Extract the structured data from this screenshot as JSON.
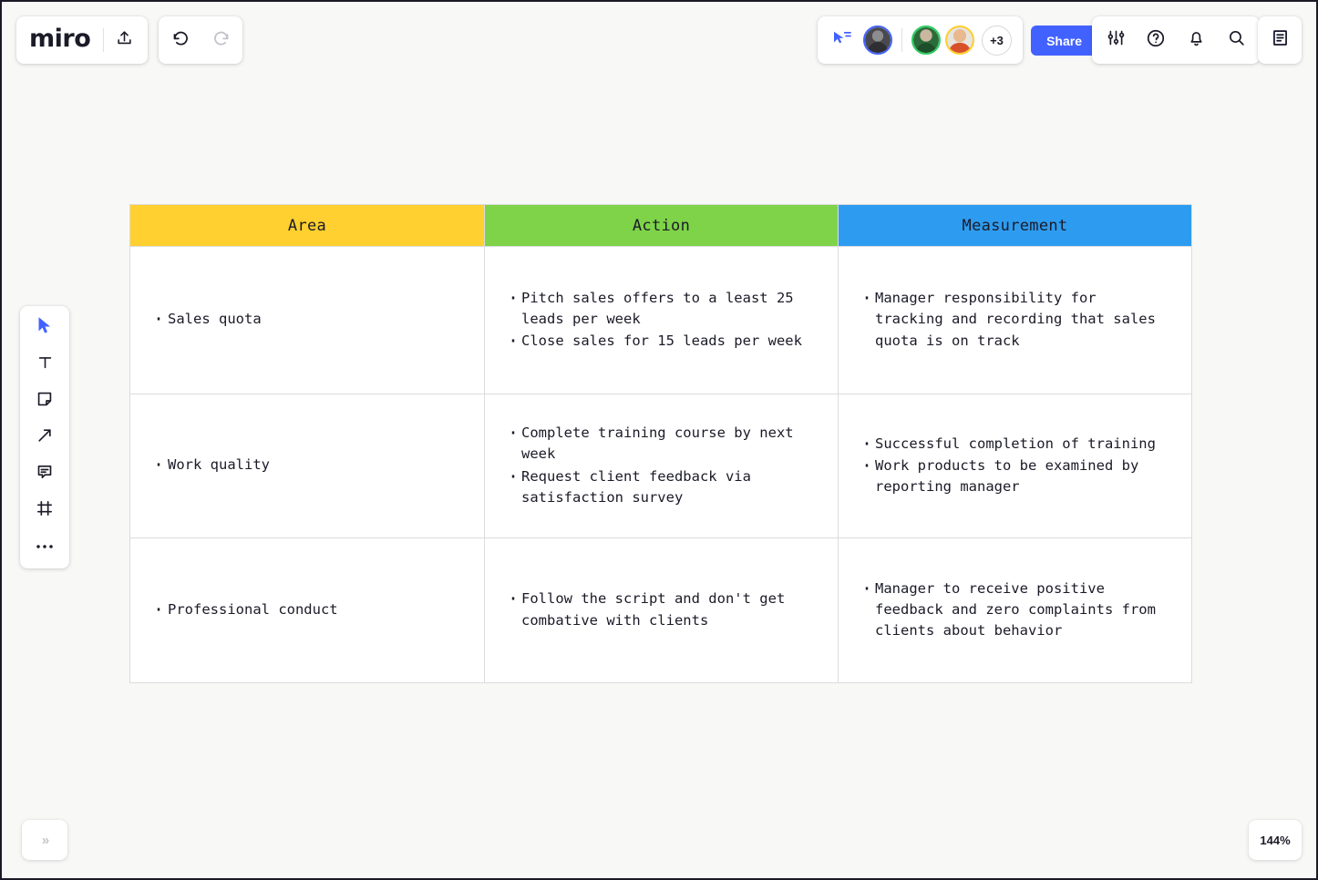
{
  "app": {
    "name": "miro",
    "zoom_level": "144%",
    "collapse_label": "»"
  },
  "toolbar_top": {
    "upload_icon": "upload-icon",
    "undo_icon": "undo-icon",
    "redo_icon": "redo-icon",
    "cursor_share_icon": "cursor-share-icon",
    "avatars": [
      {
        "name": "collaborator-1",
        "ring_color": "#4262ff"
      },
      {
        "name": "collaborator-2",
        "ring_color": "#2ecc5f"
      },
      {
        "name": "collaborator-3",
        "ring_color": "#ffd02f"
      }
    ],
    "avatar_overflow_label": "+3",
    "share_label": "Share",
    "actions": [
      {
        "name": "settings-sliders-icon"
      },
      {
        "name": "help-circle-icon"
      },
      {
        "name": "notification-bell-icon"
      },
      {
        "name": "search-icon"
      }
    ],
    "notes_icon": "notes-panel-icon"
  },
  "toolbar_left": {
    "tools": [
      {
        "name": "cursor-select-tool",
        "selected": true
      },
      {
        "name": "text-tool",
        "selected": false
      },
      {
        "name": "sticky-note-tool",
        "selected": false
      },
      {
        "name": "connector-arrow-tool",
        "selected": false
      },
      {
        "name": "comment-tool",
        "selected": false
      },
      {
        "name": "frame-tool",
        "selected": false
      },
      {
        "name": "more-tools",
        "selected": false
      }
    ]
  },
  "colors": {
    "header_area": "#FFD02F",
    "header_action": "#7ED348",
    "header_measurement": "#2D9CF0",
    "share_button": "#4262ff",
    "canvas": "#f8f8f6"
  },
  "table": {
    "headers": {
      "area": "Area",
      "action": "Action",
      "measurement": "Measurement"
    },
    "rows": [
      {
        "area": [
          "Sales quota"
        ],
        "action": [
          "Pitch sales offers to a least 25 leads per week",
          "Close sales for 15 leads per week"
        ],
        "measurement": [
          "Manager responsibility for tracking and recording that sales quota is on track"
        ]
      },
      {
        "area": [
          "Work quality"
        ],
        "action": [
          "Complete training course by next week",
          "Request client feedback via satisfaction survey"
        ],
        "measurement": [
          "Successful completion of training",
          "Work products to be examined by reporting manager"
        ]
      },
      {
        "area": [
          "Professional conduct"
        ],
        "action": [
          "Follow the script and don't get combative with clients"
        ],
        "measurement": [
          "Manager to receive positive feedback and zero complaints from clients about behavior"
        ]
      }
    ]
  }
}
